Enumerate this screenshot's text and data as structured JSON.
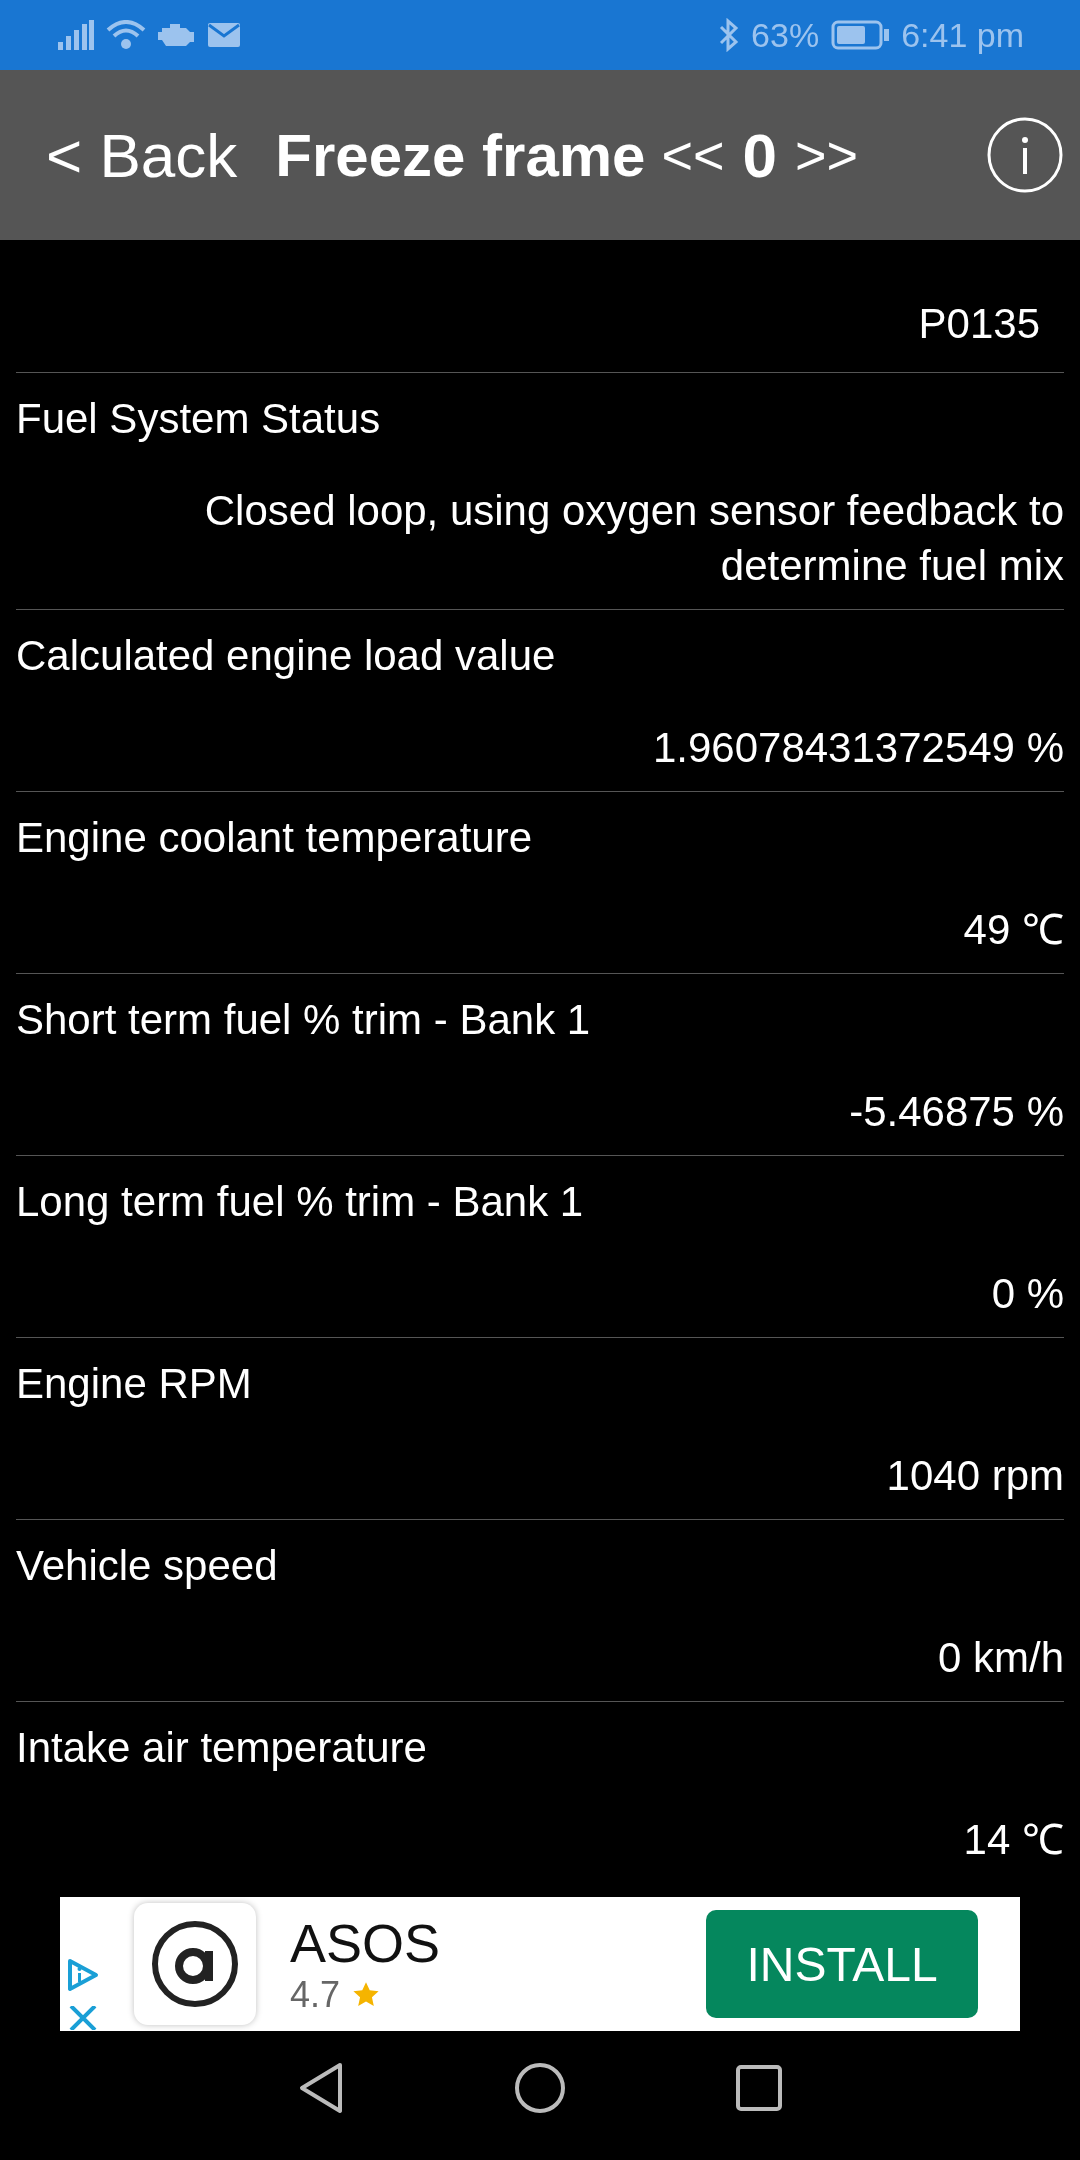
{
  "status_bar": {
    "battery": "63%",
    "time": "6:41 pm"
  },
  "header": {
    "back": "< Back",
    "title": "Freeze frame",
    "prev": "<<",
    "frame": "0",
    "next": ">>"
  },
  "rows": [
    {
      "value": "P0135"
    },
    {
      "label": "Fuel System Status",
      "value": "Closed loop, using oxygen sensor feedback to determine fuel mix"
    },
    {
      "label": "Calculated engine load value",
      "value": "1.96078431372549  %"
    },
    {
      "label": "Engine coolant temperature",
      "value": "49  ℃"
    },
    {
      "label": "Short term fuel % trim - Bank 1",
      "value": "-5.46875  %"
    },
    {
      "label": "Long term fuel % trim - Bank 1",
      "value": "0  %"
    },
    {
      "label": "Engine RPM",
      "value": "1040  rpm"
    },
    {
      "label": "Vehicle speed",
      "value": "0  km/h"
    },
    {
      "label": "Intake air temperature",
      "value": "14  ℃"
    }
  ],
  "ad": {
    "app": "ASOS",
    "rating": "4.7",
    "button": "INSTALL"
  }
}
